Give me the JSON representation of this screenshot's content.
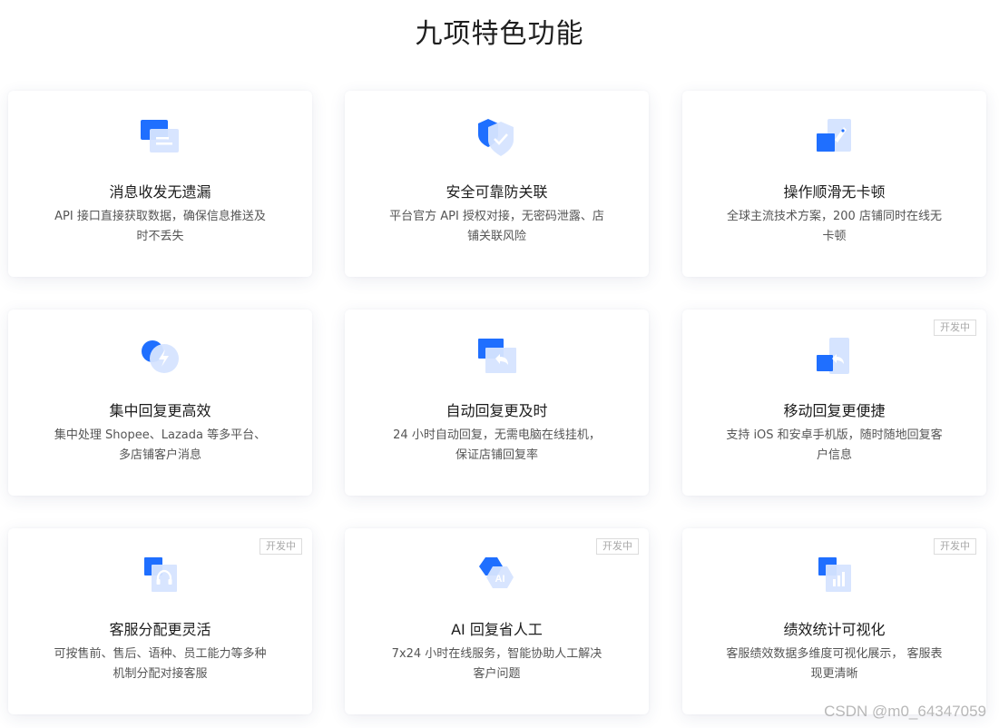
{
  "header": {
    "title": "九项特色功能"
  },
  "colors": {
    "accent": "#1f6fff",
    "accent_light": "#d6e4ff",
    "badge_border": "#dcdcdc"
  },
  "features": [
    {
      "icon": "chat-bubbles-icon",
      "title": "消息收发无遗漏",
      "desc": "API 接口直接获取数据，确保信息推送及时不丢失",
      "badge": ""
    },
    {
      "icon": "shield-check-icon",
      "title": "安全可靠防关联",
      "desc": "平台官方 API 授权对接，无密码泄露、店铺关联风险",
      "badge": ""
    },
    {
      "icon": "rocket-icon",
      "title": "操作顺滑无卡顿",
      "desc": "全球主流技术方案，200 店铺同时在线无卡顿",
      "badge": ""
    },
    {
      "icon": "lightning-circle-icon",
      "title": "集中回复更高效",
      "desc": "集中处理 Shopee、Lazada 等多平台、多店铺客户消息",
      "badge": ""
    },
    {
      "icon": "auto-reply-icon",
      "title": "自动回复更及时",
      "desc": "24 小时自动回复，无需电脑在线挂机，保证店铺回复率",
      "badge": ""
    },
    {
      "icon": "mobile-reply-icon",
      "title": "移动回复更便捷",
      "desc": "支持 iOS 和安卓手机版，随时随地回复客户信息",
      "badge": "开发中"
    },
    {
      "icon": "headset-icon",
      "title": "客服分配更灵活",
      "desc": "可按售前、售后、语种、员工能力等多种机制分配对接客服",
      "badge": "开发中"
    },
    {
      "icon": "ai-hexagon-icon",
      "title": "AI 回复省人工",
      "desc": "7x24 小时在线服务，智能协助人工解决客户问题",
      "badge": "开发中"
    },
    {
      "icon": "bar-chart-icon",
      "title": "绩效统计可视化",
      "desc": "客服绩效数据多维度可视化展示， 客服表现更清晰",
      "badge": "开发中"
    }
  ],
  "watermark": "CSDN @m0_64347059"
}
